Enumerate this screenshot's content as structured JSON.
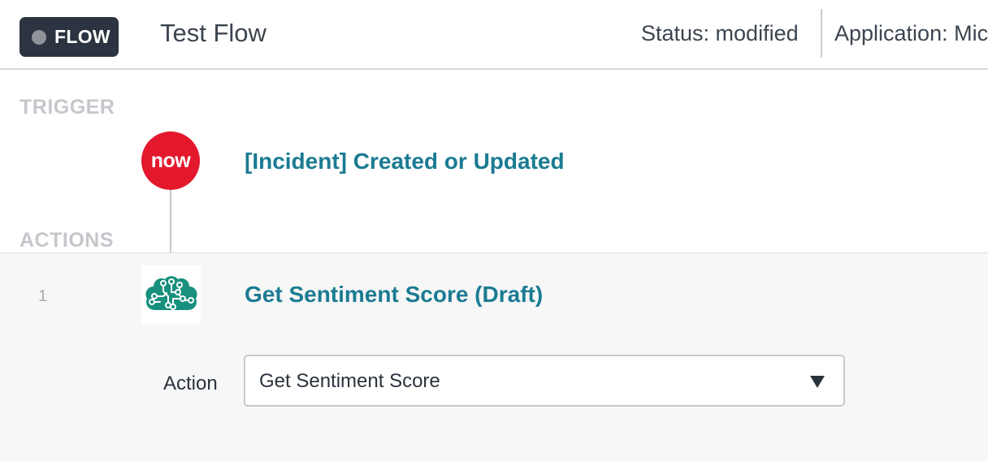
{
  "header": {
    "badge_label": "FLOW",
    "title": "Test Flow",
    "status": "Status: modified",
    "application": "Application: Mic"
  },
  "sections": {
    "trigger_label": "TRIGGER",
    "actions_label": "ACTIONS"
  },
  "trigger": {
    "logo_text": "now",
    "title": "[Incident] Created or Updated"
  },
  "action": {
    "step_number": "1",
    "icon": "brain-circuit-icon",
    "title": "Get Sentiment Score (Draft)",
    "field_label": "Action",
    "selected_value": "Get Sentiment Score"
  },
  "colors": {
    "header_badge": "#2b3440",
    "link_teal": "#1b7b92",
    "now_red": "#e3182d",
    "brain_green": "#17907d"
  }
}
